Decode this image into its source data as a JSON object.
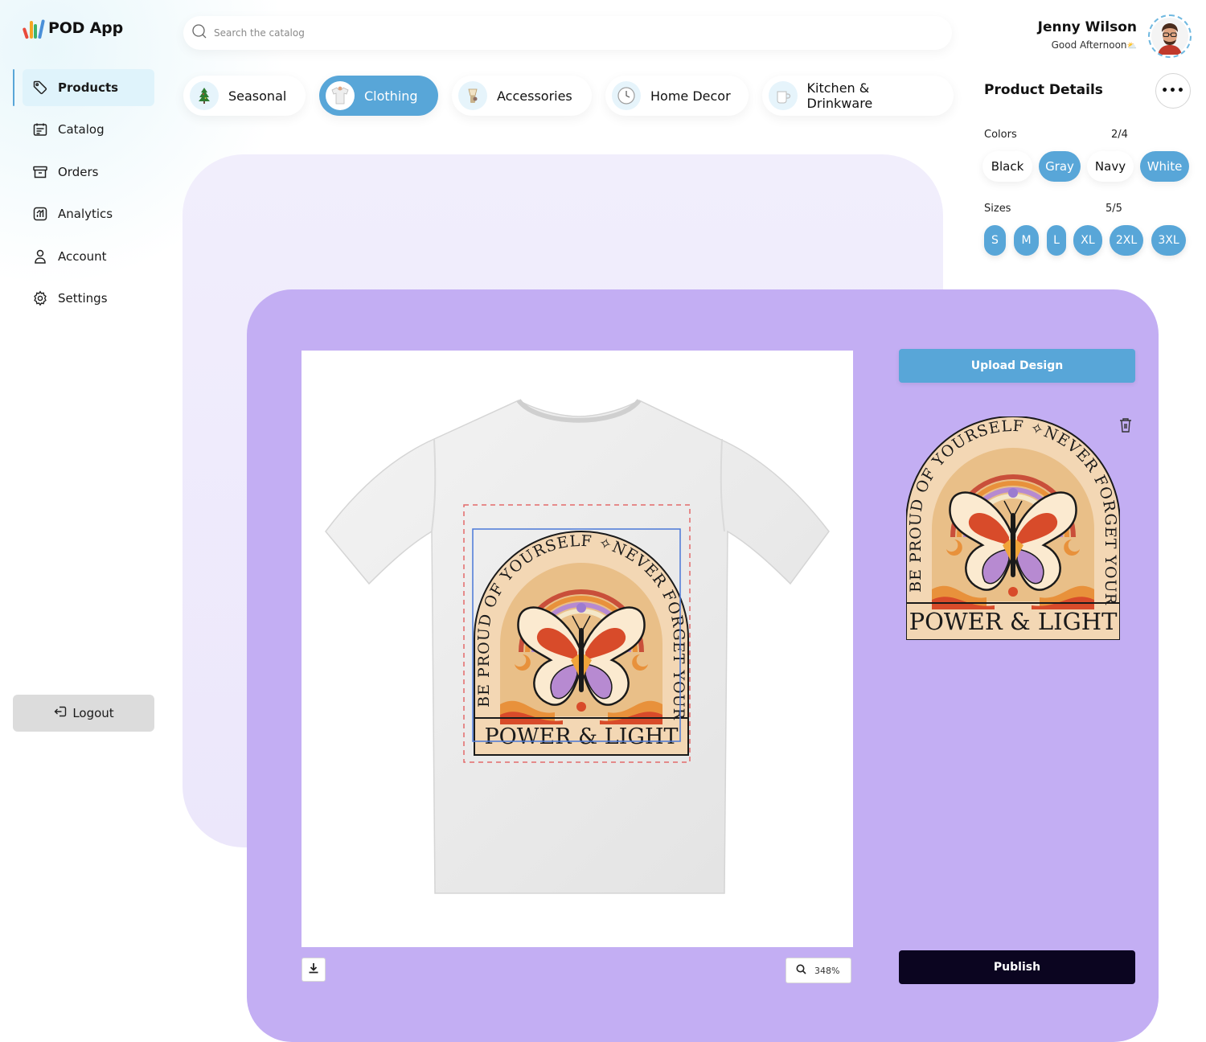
{
  "app": {
    "name": "POD App",
    "brand_colors": [
      "#e94b3c",
      "#f5a623",
      "#3fb36b",
      "#4a90d9"
    ]
  },
  "search": {
    "placeholder": "Search the catalog"
  },
  "user": {
    "name": "Jenny Wilson",
    "greeting": "Good Afternoon"
  },
  "sidebar": {
    "items": [
      {
        "label": "Products",
        "icon": "tag-icon",
        "active": true
      },
      {
        "label": "Catalog",
        "icon": "catalog-icon",
        "active": false
      },
      {
        "label": "Orders",
        "icon": "archive-box-icon",
        "active": false
      },
      {
        "label": "Analytics",
        "icon": "chart-icon",
        "active": false
      },
      {
        "label": "Account",
        "icon": "user-icon",
        "active": false
      },
      {
        "label": "Settings",
        "icon": "gear-icon",
        "active": false
      }
    ],
    "logout_label": "Logout"
  },
  "categories": [
    {
      "label": "Seasonal",
      "icon": "christmas-tree-icon",
      "active": false
    },
    {
      "label": "Clothing",
      "icon": "tshirt-icon",
      "active": true
    },
    {
      "label": "Accessories",
      "icon": "accessory-icon",
      "active": false
    },
    {
      "label": "Home Decor",
      "icon": "clock-icon",
      "active": false
    },
    {
      "label": "Kitchen & Drinkware",
      "icon": "mug-icon",
      "active": false
    }
  ],
  "product_details": {
    "title": "Product Details",
    "more_label": "•••",
    "colors_label": "Colors",
    "colors_count": "2/4",
    "colors": [
      {
        "label": "Black",
        "selected": false
      },
      {
        "label": "Gray",
        "selected": true
      },
      {
        "label": "Navy",
        "selected": false
      },
      {
        "label": "White",
        "selected": true
      }
    ],
    "sizes_label": "Sizes",
    "sizes_count": "5/5",
    "sizes": [
      "S",
      "M",
      "L",
      "XL",
      "2XL",
      "3XL"
    ]
  },
  "editor": {
    "upload_label": "Upload Design",
    "publish_label": "Publish",
    "zoom": "348%",
    "design": {
      "arc_text": "BE PROUD OF YOURSELF ✧NEVER FORGET YOUR",
      "bottom_text": "POWER & LIGHT"
    }
  },
  "colors": {
    "accent": "#58a6d8",
    "editor_bg": "#c3aef3",
    "publish": "#0b0520"
  }
}
